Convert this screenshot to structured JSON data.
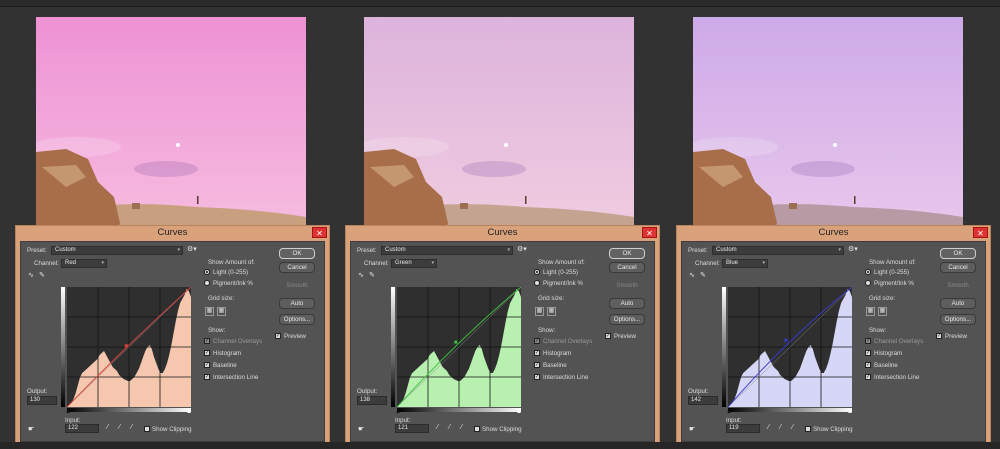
{
  "panels": [
    {
      "title": "Curves",
      "close_label": "✕",
      "preset_label": "Preset:",
      "preset_value": "Custom",
      "channel_label": "Channel:",
      "channel_value": "Red",
      "output_label": "Output:",
      "output_value": "130",
      "input_label": "Input:",
      "input_value": "122",
      "show_clipping": "Show Clipping",
      "show_amount_label": "Show Amount of:",
      "light_label": "Light  (0-255)",
      "pigment_label": "Pigment/Ink %",
      "grid_size_label": "Grid size:",
      "show_label": "Show:",
      "channel_overlays": "Channel Overlays",
      "histogram": "Histogram",
      "baseline": "Baseline",
      "intersection_line": "Intersection Line",
      "ok": "OK",
      "cancel": "Cancel",
      "smooth": "Smooth",
      "auto": "Auto",
      "options": "Options...",
      "preview": "Preview",
      "color": "#f4c7ae",
      "line_color": "#d8423a",
      "point_input": 122,
      "point_output": 130
    },
    {
      "title": "Curves",
      "close_label": "✕",
      "preset_label": "Preset:",
      "preset_value": "Custom",
      "channel_label": "Channel:",
      "channel_value": "Green",
      "output_label": "Output:",
      "output_value": "138",
      "input_label": "Input:",
      "input_value": "121",
      "show_clipping": "Show Clipping",
      "show_amount_label": "Show Amount of:",
      "light_label": "Light  (0-255)",
      "pigment_label": "Pigment/Ink %",
      "grid_size_label": "Grid size:",
      "show_label": "Show:",
      "channel_overlays": "Channel Overlays",
      "histogram": "Histogram",
      "baseline": "Baseline",
      "intersection_line": "Intersection Line",
      "ok": "OK",
      "cancel": "Cancel",
      "smooth": "Smooth",
      "auto": "Auto",
      "options": "Options...",
      "preview": "Preview",
      "color": "#b8f0b0",
      "line_color": "#3fbf3f",
      "point_input": 121,
      "point_output": 138
    },
    {
      "title": "Curves",
      "close_label": "✕",
      "preset_label": "Preset:",
      "preset_value": "Custom",
      "channel_label": "Channel:",
      "channel_value": "Blue",
      "output_label": "Output:",
      "output_value": "142",
      "input_label": "Input:",
      "input_value": "119",
      "show_clipping": "Show Clipping",
      "show_amount_label": "Show Amount of:",
      "light_label": "Light  (0-255)",
      "pigment_label": "Pigment/Ink %",
      "grid_size_label": "Grid size:",
      "show_label": "Show:",
      "channel_overlays": "Channel Overlays",
      "histogram": "Histogram",
      "baseline": "Baseline",
      "intersection_line": "Intersection Line",
      "ok": "OK",
      "cancel": "Cancel",
      "smooth": "Smooth",
      "auto": "Auto",
      "options": "Options...",
      "preview": "Preview",
      "color": "#d6d6f6",
      "line_color": "#3a3acf",
      "point_input": 119,
      "point_output": 142
    }
  ],
  "photos": [
    {
      "sky_top": "#ee92d4",
      "sky_bottom": "#f6bde0",
      "ground": "#c8a07f"
    },
    {
      "sky_top": "#ddb3dc",
      "sky_bottom": "#f0cde0",
      "ground": "#c4a391"
    },
    {
      "sky_top": "#cdaae8",
      "sky_bottom": "#e8c8ec",
      "ground": "#b89aa5"
    }
  ]
}
